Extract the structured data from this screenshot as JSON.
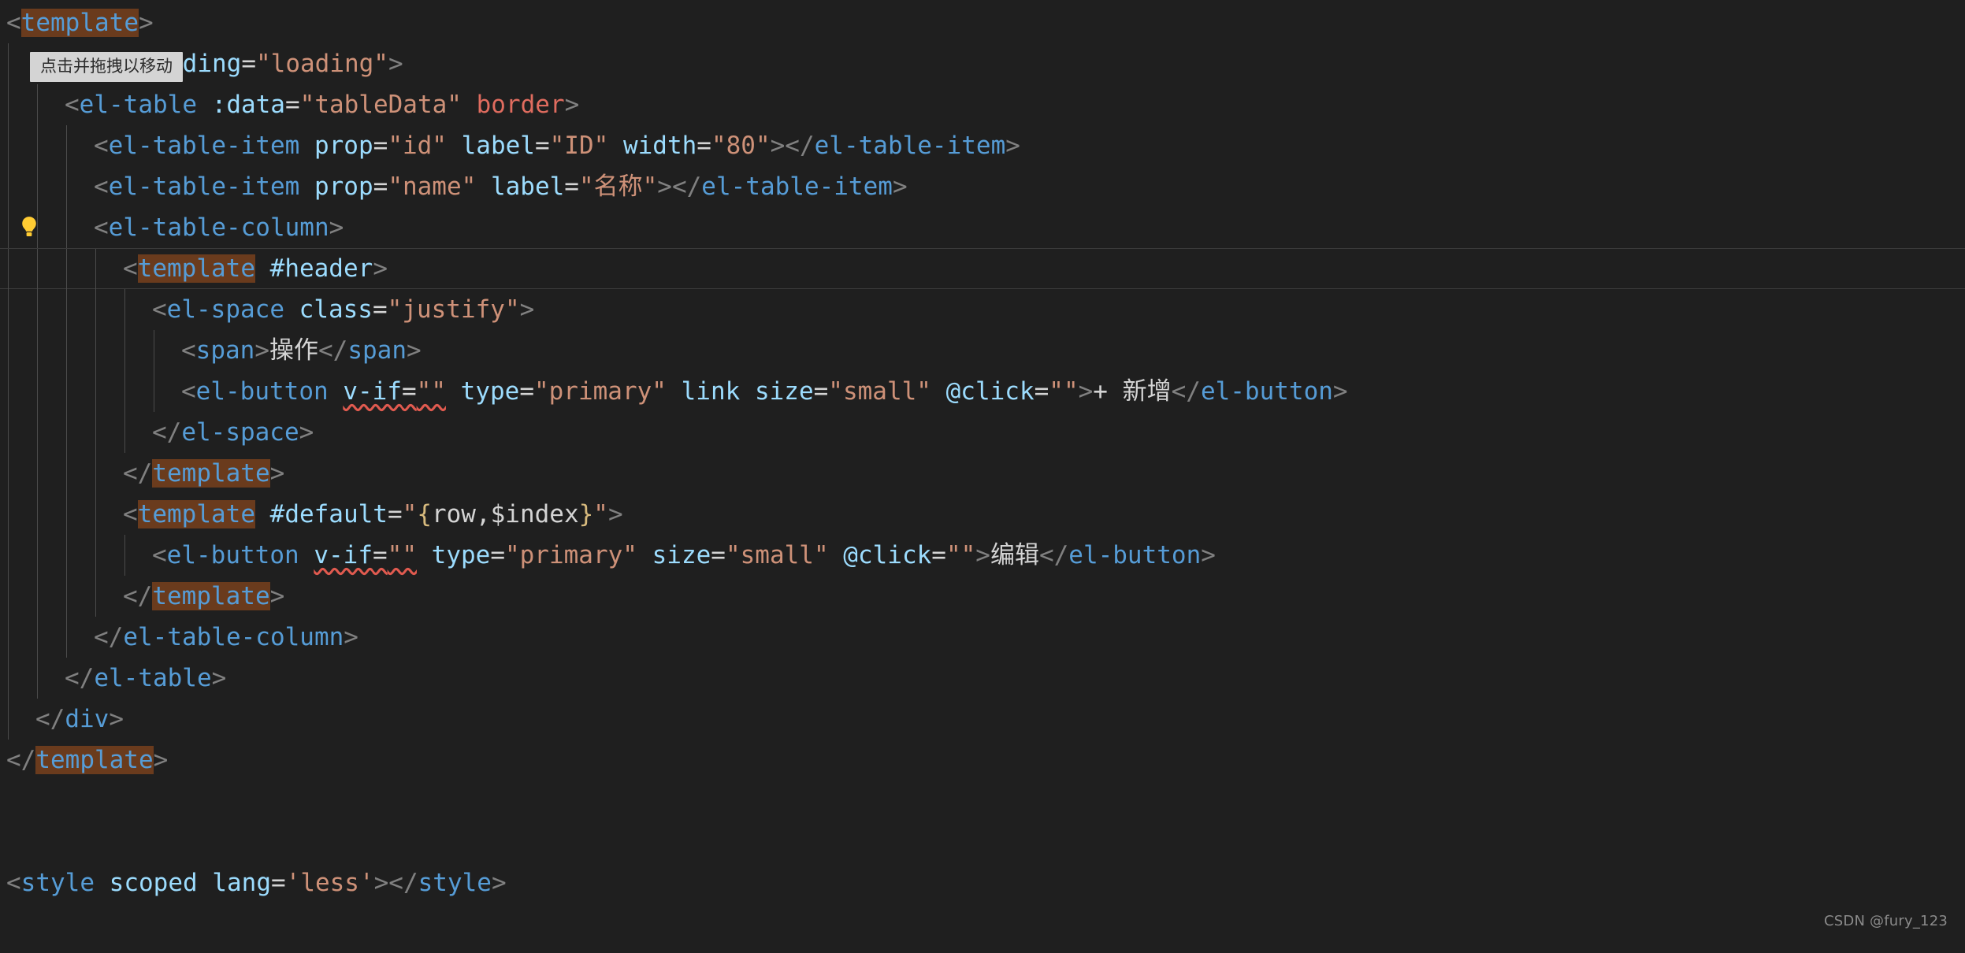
{
  "editor": {
    "background_color": "#1f1f1f",
    "foreground_color": "#cccccc",
    "current_line_index": 5,
    "lightbulb_line_index": 5,
    "watermark": "CSDN @fury_123",
    "drag_tooltip": "点击并拖拽以移动",
    "colors": {
      "tag": "#569cd6",
      "attribute": "#9cdcfe",
      "string": "#ce9178",
      "text": "#d4d4d4",
      "punctuation": "#808080",
      "keyword_red": "#e06c5f",
      "brace_yellow": "#d7ba7d",
      "word_highlight": "#6a3b1d",
      "squiggle": "#e05a4f",
      "indent_guide": "#4b4b4b"
    },
    "icons": {
      "lightbulb": "lightbulb-icon"
    }
  },
  "code_lines": [
    {
      "indent": 0,
      "guides": 0,
      "tokens": [
        {
          "t": "<",
          "c": "punc"
        },
        {
          "t": "template",
          "c": "tag hl"
        },
        {
          "t": ">",
          "c": "punc"
        }
      ]
    },
    {
      "indent": 1,
      "guides": 1,
      "tokens": [
        {
          "t": "<",
          "c": "punc"
        },
        {
          "t": "div",
          "c": "tag"
        },
        {
          "t": " ",
          "c": "txt"
        },
        {
          "t": "v-loading",
          "c": "attr"
        },
        {
          "t": "=",
          "c": "txt"
        },
        {
          "t": "\"loading\"",
          "c": "str"
        },
        {
          "t": ">",
          "c": "punc"
        }
      ]
    },
    {
      "indent": 2,
      "guides": 2,
      "tokens": [
        {
          "t": "<",
          "c": "punc"
        },
        {
          "t": "el-table",
          "c": "tag"
        },
        {
          "t": " ",
          "c": "txt"
        },
        {
          "t": ":data",
          "c": "attr"
        },
        {
          "t": "=",
          "c": "txt"
        },
        {
          "t": "\"tableData\"",
          "c": "str"
        },
        {
          "t": " ",
          "c": "txt"
        },
        {
          "t": "border",
          "c": "kw"
        },
        {
          "t": ">",
          "c": "punc"
        }
      ]
    },
    {
      "indent": 3,
      "guides": 3,
      "tokens": [
        {
          "t": "<",
          "c": "punc"
        },
        {
          "t": "el-table-item",
          "c": "tag"
        },
        {
          "t": " ",
          "c": "txt"
        },
        {
          "t": "prop",
          "c": "attr"
        },
        {
          "t": "=",
          "c": "txt"
        },
        {
          "t": "\"id\"",
          "c": "str"
        },
        {
          "t": " ",
          "c": "txt"
        },
        {
          "t": "label",
          "c": "attr"
        },
        {
          "t": "=",
          "c": "txt"
        },
        {
          "t": "\"ID\"",
          "c": "str"
        },
        {
          "t": " ",
          "c": "txt"
        },
        {
          "t": "width",
          "c": "attr"
        },
        {
          "t": "=",
          "c": "txt"
        },
        {
          "t": "\"80\"",
          "c": "str"
        },
        {
          "t": "></",
          "c": "punc"
        },
        {
          "t": "el-table-item",
          "c": "tag"
        },
        {
          "t": ">",
          "c": "punc"
        }
      ]
    },
    {
      "indent": 3,
      "guides": 3,
      "tokens": [
        {
          "t": "<",
          "c": "punc"
        },
        {
          "t": "el-table-item",
          "c": "tag"
        },
        {
          "t": " ",
          "c": "txt"
        },
        {
          "t": "prop",
          "c": "attr"
        },
        {
          "t": "=",
          "c": "txt"
        },
        {
          "t": "\"name\"",
          "c": "str"
        },
        {
          "t": " ",
          "c": "txt"
        },
        {
          "t": "label",
          "c": "attr"
        },
        {
          "t": "=",
          "c": "txt"
        },
        {
          "t": "\"名称\"",
          "c": "str"
        },
        {
          "t": "></",
          "c": "punc"
        },
        {
          "t": "el-table-item",
          "c": "tag"
        },
        {
          "t": ">",
          "c": "punc"
        }
      ]
    },
    {
      "indent": 3,
      "guides": 3,
      "tokens": [
        {
          "t": "<",
          "c": "punc"
        },
        {
          "t": "el-table-column",
          "c": "tag"
        },
        {
          "t": ">",
          "c": "punc"
        }
      ]
    },
    {
      "indent": 4,
      "guides": 4,
      "current": true,
      "tokens": [
        {
          "t": "<",
          "c": "punc"
        },
        {
          "t": "template",
          "c": "tag hl"
        },
        {
          "t": " ",
          "c": "txt"
        },
        {
          "t": "#header",
          "c": "attr"
        },
        {
          "t": ">",
          "c": "punc"
        }
      ]
    },
    {
      "indent": 5,
      "guides": 5,
      "tokens": [
        {
          "t": "<",
          "c": "punc"
        },
        {
          "t": "el-space",
          "c": "tag"
        },
        {
          "t": " ",
          "c": "txt"
        },
        {
          "t": "class",
          "c": "attr"
        },
        {
          "t": "=",
          "c": "txt"
        },
        {
          "t": "\"justify\"",
          "c": "str"
        },
        {
          "t": ">",
          "c": "punc"
        }
      ]
    },
    {
      "indent": 6,
      "guides": 6,
      "tokens": [
        {
          "t": "<",
          "c": "punc"
        },
        {
          "t": "span",
          "c": "tag"
        },
        {
          "t": ">",
          "c": "punc"
        },
        {
          "t": "操作",
          "c": "txt"
        },
        {
          "t": "</",
          "c": "punc"
        },
        {
          "t": "span",
          "c": "tag"
        },
        {
          "t": ">",
          "c": "punc"
        }
      ]
    },
    {
      "indent": 6,
      "guides": 6,
      "tokens": [
        {
          "t": "<",
          "c": "punc"
        },
        {
          "t": "el-button",
          "c": "tag"
        },
        {
          "t": " ",
          "c": "txt"
        },
        {
          "t": "v-if",
          "c": "attr squiggle"
        },
        {
          "t": "=",
          "c": "txt squiggle"
        },
        {
          "t": "\"\"",
          "c": "str squiggle"
        },
        {
          "t": " ",
          "c": "txt"
        },
        {
          "t": "type",
          "c": "attr"
        },
        {
          "t": "=",
          "c": "txt"
        },
        {
          "t": "\"primary\"",
          "c": "str"
        },
        {
          "t": " ",
          "c": "txt"
        },
        {
          "t": "link",
          "c": "attr"
        },
        {
          "t": " ",
          "c": "txt"
        },
        {
          "t": "size",
          "c": "attr"
        },
        {
          "t": "=",
          "c": "txt"
        },
        {
          "t": "\"small\"",
          "c": "str"
        },
        {
          "t": " ",
          "c": "txt"
        },
        {
          "t": "@click",
          "c": "attr"
        },
        {
          "t": "=",
          "c": "txt"
        },
        {
          "t": "\"\"",
          "c": "str"
        },
        {
          "t": ">",
          "c": "punc"
        },
        {
          "t": "+ 新增",
          "c": "txt"
        },
        {
          "t": "</",
          "c": "punc"
        },
        {
          "t": "el-button",
          "c": "tag"
        },
        {
          "t": ">",
          "c": "punc"
        }
      ]
    },
    {
      "indent": 5,
      "guides": 5,
      "tokens": [
        {
          "t": "</",
          "c": "punc"
        },
        {
          "t": "el-space",
          "c": "tag"
        },
        {
          "t": ">",
          "c": "punc"
        }
      ]
    },
    {
      "indent": 4,
      "guides": 4,
      "tokens": [
        {
          "t": "</",
          "c": "punc"
        },
        {
          "t": "template",
          "c": "tag hl"
        },
        {
          "t": ">",
          "c": "punc"
        }
      ]
    },
    {
      "indent": 4,
      "guides": 4,
      "tokens": [
        {
          "t": "<",
          "c": "punc"
        },
        {
          "t": "template",
          "c": "tag hl"
        },
        {
          "t": " ",
          "c": "txt"
        },
        {
          "t": "#default",
          "c": "attr"
        },
        {
          "t": "=",
          "c": "txt"
        },
        {
          "t": "\"",
          "c": "str"
        },
        {
          "t": "{",
          "c": "brace"
        },
        {
          "t": "row,$index",
          "c": "txt"
        },
        {
          "t": "}",
          "c": "brace"
        },
        {
          "t": "\"",
          "c": "str"
        },
        {
          "t": ">",
          "c": "punc"
        }
      ]
    },
    {
      "indent": 5,
      "guides": 5,
      "tokens": [
        {
          "t": "<",
          "c": "punc"
        },
        {
          "t": "el-button",
          "c": "tag"
        },
        {
          "t": " ",
          "c": "txt"
        },
        {
          "t": "v-if",
          "c": "attr squiggle"
        },
        {
          "t": "=",
          "c": "txt squiggle"
        },
        {
          "t": "\"\"",
          "c": "str squiggle"
        },
        {
          "t": " ",
          "c": "txt"
        },
        {
          "t": "type",
          "c": "attr"
        },
        {
          "t": "=",
          "c": "txt"
        },
        {
          "t": "\"primary\"",
          "c": "str"
        },
        {
          "t": " ",
          "c": "txt"
        },
        {
          "t": "size",
          "c": "attr"
        },
        {
          "t": "=",
          "c": "txt"
        },
        {
          "t": "\"small\"",
          "c": "str"
        },
        {
          "t": " ",
          "c": "txt"
        },
        {
          "t": "@click",
          "c": "attr"
        },
        {
          "t": "=",
          "c": "txt"
        },
        {
          "t": "\"\"",
          "c": "str"
        },
        {
          "t": ">",
          "c": "punc"
        },
        {
          "t": "编辑",
          "c": "txt"
        },
        {
          "t": "</",
          "c": "punc"
        },
        {
          "t": "el-button",
          "c": "tag"
        },
        {
          "t": ">",
          "c": "punc"
        }
      ]
    },
    {
      "indent": 4,
      "guides": 4,
      "tokens": [
        {
          "t": "</",
          "c": "punc"
        },
        {
          "t": "template",
          "c": "tag hl"
        },
        {
          "t": ">",
          "c": "punc"
        }
      ]
    },
    {
      "indent": 3,
      "guides": 3,
      "tokens": [
        {
          "t": "</",
          "c": "punc"
        },
        {
          "t": "el-table-column",
          "c": "tag"
        },
        {
          "t": ">",
          "c": "punc"
        }
      ]
    },
    {
      "indent": 2,
      "guides": 2,
      "tokens": [
        {
          "t": "</",
          "c": "punc"
        },
        {
          "t": "el-table",
          "c": "tag"
        },
        {
          "t": ">",
          "c": "punc"
        }
      ]
    },
    {
      "indent": 1,
      "guides": 1,
      "tokens": [
        {
          "t": "</",
          "c": "punc"
        },
        {
          "t": "div",
          "c": "tag"
        },
        {
          "t": ">",
          "c": "punc"
        }
      ]
    },
    {
      "indent": 0,
      "guides": 0,
      "tokens": [
        {
          "t": "</",
          "c": "punc"
        },
        {
          "t": "template",
          "c": "tag hl"
        },
        {
          "t": ">",
          "c": "punc"
        }
      ]
    },
    {
      "indent": 0,
      "guides": 0,
      "tokens": []
    },
    {
      "indent": 0,
      "guides": 0,
      "tokens": []
    },
    {
      "indent": 0,
      "guides": 0,
      "tokens": [
        {
          "t": "<",
          "c": "punc"
        },
        {
          "t": "style",
          "c": "tag"
        },
        {
          "t": " ",
          "c": "txt"
        },
        {
          "t": "scoped",
          "c": "attr"
        },
        {
          "t": " ",
          "c": "txt"
        },
        {
          "t": "lang",
          "c": "attr"
        },
        {
          "t": "=",
          "c": "txt"
        },
        {
          "t": "'less'",
          "c": "str"
        },
        {
          "t": "></",
          "c": "punc"
        },
        {
          "t": "style",
          "c": "tag"
        },
        {
          "t": ">",
          "c": "punc"
        }
      ]
    }
  ]
}
